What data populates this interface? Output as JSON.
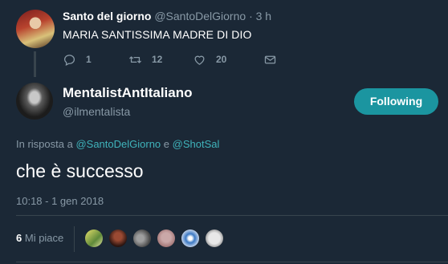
{
  "parent_tweet": {
    "name": "Santo del giorno",
    "handle": "@SantoDelGiorno",
    "dot": "·",
    "time": "3 h",
    "text": "MARIA SANTISSIMA MADRE DI DIO",
    "reply_count": "1",
    "retweet_count": "12",
    "like_count": "20",
    "icons": [
      "reply-icon",
      "retweet-icon",
      "heart-icon",
      "mail-icon"
    ]
  },
  "main_tweet": {
    "name": "MentalistAntItaliano",
    "handle": "@ilmentalista",
    "follow_label": "Following",
    "reply_prefix": "In risposta a",
    "reply_mention_1": "@SantoDelGiorno",
    "reply_conj": "e",
    "reply_mention_2": "@ShotSal",
    "text": "che è successo",
    "timestamp": "10:18 - 1 gen 2018",
    "likes_number": "6",
    "likes_label": "Mi piace"
  },
  "colors": {
    "background": "#1b2836",
    "accent": "#1b95a0",
    "muted": "#8899a6",
    "divider": "#38444d"
  }
}
